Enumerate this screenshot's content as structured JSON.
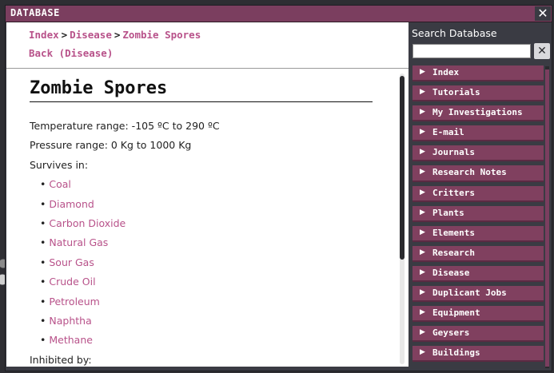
{
  "window": {
    "title": "DATABASE",
    "close_symbol": "✕"
  },
  "breadcrumb": {
    "items": [
      "Index",
      "Disease",
      "Zombie Spores"
    ],
    "separator": ">",
    "back_label": "Back (Disease)"
  },
  "article": {
    "title": "Zombie Spores",
    "temperature": "Temperature range: -105 ºC to 290 ºC",
    "pressure": "Pressure range: 0 Kg to 1000 Kg",
    "survives_label": "Survives in:",
    "survives_in": [
      "Coal",
      "Diamond",
      "Carbon Dioxide",
      "Natural Gas",
      "Sour Gas",
      "Crude Oil",
      "Petroleum",
      "Naphtha",
      "Methane"
    ],
    "inhibited_label": "Inhibited by:"
  },
  "search": {
    "label": "Search Database",
    "value": "",
    "placeholder": "",
    "clear_symbol": "✕"
  },
  "nav": {
    "arrow_symbol": "▶",
    "items": [
      "Index",
      "Tutorials",
      "My Investigations",
      "E-mail",
      "Journals",
      "Research Notes",
      "Critters",
      "Plants",
      "Elements",
      "Research",
      "Disease",
      "Duplicant Jobs",
      "Equipment",
      "Geysers",
      "Buildings"
    ]
  },
  "colors": {
    "accent": "#7b3e5f",
    "link": "#b8528a",
    "nav_item": "#80405f"
  }
}
